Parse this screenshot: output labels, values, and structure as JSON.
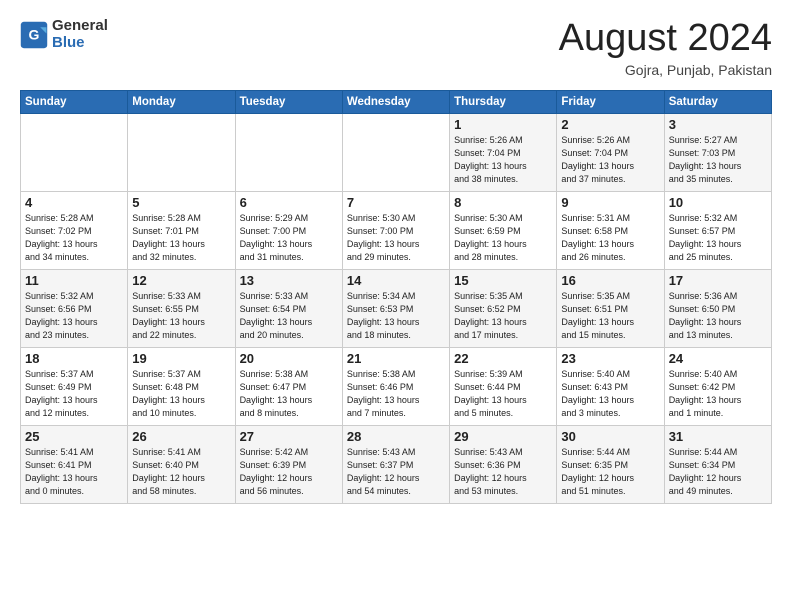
{
  "logo": {
    "line1": "General",
    "line2": "Blue"
  },
  "title": "August 2024",
  "location": "Gojra, Punjab, Pakistan",
  "headers": [
    "Sunday",
    "Monday",
    "Tuesday",
    "Wednesday",
    "Thursday",
    "Friday",
    "Saturday"
  ],
  "weeks": [
    [
      {
        "day": "",
        "info": ""
      },
      {
        "day": "",
        "info": ""
      },
      {
        "day": "",
        "info": ""
      },
      {
        "day": "",
        "info": ""
      },
      {
        "day": "1",
        "info": "Sunrise: 5:26 AM\nSunset: 7:04 PM\nDaylight: 13 hours\nand 38 minutes."
      },
      {
        "day": "2",
        "info": "Sunrise: 5:26 AM\nSunset: 7:04 PM\nDaylight: 13 hours\nand 37 minutes."
      },
      {
        "day": "3",
        "info": "Sunrise: 5:27 AM\nSunset: 7:03 PM\nDaylight: 13 hours\nand 35 minutes."
      }
    ],
    [
      {
        "day": "4",
        "info": "Sunrise: 5:28 AM\nSunset: 7:02 PM\nDaylight: 13 hours\nand 34 minutes."
      },
      {
        "day": "5",
        "info": "Sunrise: 5:28 AM\nSunset: 7:01 PM\nDaylight: 13 hours\nand 32 minutes."
      },
      {
        "day": "6",
        "info": "Sunrise: 5:29 AM\nSunset: 7:00 PM\nDaylight: 13 hours\nand 31 minutes."
      },
      {
        "day": "7",
        "info": "Sunrise: 5:30 AM\nSunset: 7:00 PM\nDaylight: 13 hours\nand 29 minutes."
      },
      {
        "day": "8",
        "info": "Sunrise: 5:30 AM\nSunset: 6:59 PM\nDaylight: 13 hours\nand 28 minutes."
      },
      {
        "day": "9",
        "info": "Sunrise: 5:31 AM\nSunset: 6:58 PM\nDaylight: 13 hours\nand 26 minutes."
      },
      {
        "day": "10",
        "info": "Sunrise: 5:32 AM\nSunset: 6:57 PM\nDaylight: 13 hours\nand 25 minutes."
      }
    ],
    [
      {
        "day": "11",
        "info": "Sunrise: 5:32 AM\nSunset: 6:56 PM\nDaylight: 13 hours\nand 23 minutes."
      },
      {
        "day": "12",
        "info": "Sunrise: 5:33 AM\nSunset: 6:55 PM\nDaylight: 13 hours\nand 22 minutes."
      },
      {
        "day": "13",
        "info": "Sunrise: 5:33 AM\nSunset: 6:54 PM\nDaylight: 13 hours\nand 20 minutes."
      },
      {
        "day": "14",
        "info": "Sunrise: 5:34 AM\nSunset: 6:53 PM\nDaylight: 13 hours\nand 18 minutes."
      },
      {
        "day": "15",
        "info": "Sunrise: 5:35 AM\nSunset: 6:52 PM\nDaylight: 13 hours\nand 17 minutes."
      },
      {
        "day": "16",
        "info": "Sunrise: 5:35 AM\nSunset: 6:51 PM\nDaylight: 13 hours\nand 15 minutes."
      },
      {
        "day": "17",
        "info": "Sunrise: 5:36 AM\nSunset: 6:50 PM\nDaylight: 13 hours\nand 13 minutes."
      }
    ],
    [
      {
        "day": "18",
        "info": "Sunrise: 5:37 AM\nSunset: 6:49 PM\nDaylight: 13 hours\nand 12 minutes."
      },
      {
        "day": "19",
        "info": "Sunrise: 5:37 AM\nSunset: 6:48 PM\nDaylight: 13 hours\nand 10 minutes."
      },
      {
        "day": "20",
        "info": "Sunrise: 5:38 AM\nSunset: 6:47 PM\nDaylight: 13 hours\nand 8 minutes."
      },
      {
        "day": "21",
        "info": "Sunrise: 5:38 AM\nSunset: 6:46 PM\nDaylight: 13 hours\nand 7 minutes."
      },
      {
        "day": "22",
        "info": "Sunrise: 5:39 AM\nSunset: 6:44 PM\nDaylight: 13 hours\nand 5 minutes."
      },
      {
        "day": "23",
        "info": "Sunrise: 5:40 AM\nSunset: 6:43 PM\nDaylight: 13 hours\nand 3 minutes."
      },
      {
        "day": "24",
        "info": "Sunrise: 5:40 AM\nSunset: 6:42 PM\nDaylight: 13 hours\nand 1 minute."
      }
    ],
    [
      {
        "day": "25",
        "info": "Sunrise: 5:41 AM\nSunset: 6:41 PM\nDaylight: 13 hours\nand 0 minutes."
      },
      {
        "day": "26",
        "info": "Sunrise: 5:41 AM\nSunset: 6:40 PM\nDaylight: 12 hours\nand 58 minutes."
      },
      {
        "day": "27",
        "info": "Sunrise: 5:42 AM\nSunset: 6:39 PM\nDaylight: 12 hours\nand 56 minutes."
      },
      {
        "day": "28",
        "info": "Sunrise: 5:43 AM\nSunset: 6:37 PM\nDaylight: 12 hours\nand 54 minutes."
      },
      {
        "day": "29",
        "info": "Sunrise: 5:43 AM\nSunset: 6:36 PM\nDaylight: 12 hours\nand 53 minutes."
      },
      {
        "day": "30",
        "info": "Sunrise: 5:44 AM\nSunset: 6:35 PM\nDaylight: 12 hours\nand 51 minutes."
      },
      {
        "day": "31",
        "info": "Sunrise: 5:44 AM\nSunset: 6:34 PM\nDaylight: 12 hours\nand 49 minutes."
      }
    ]
  ]
}
